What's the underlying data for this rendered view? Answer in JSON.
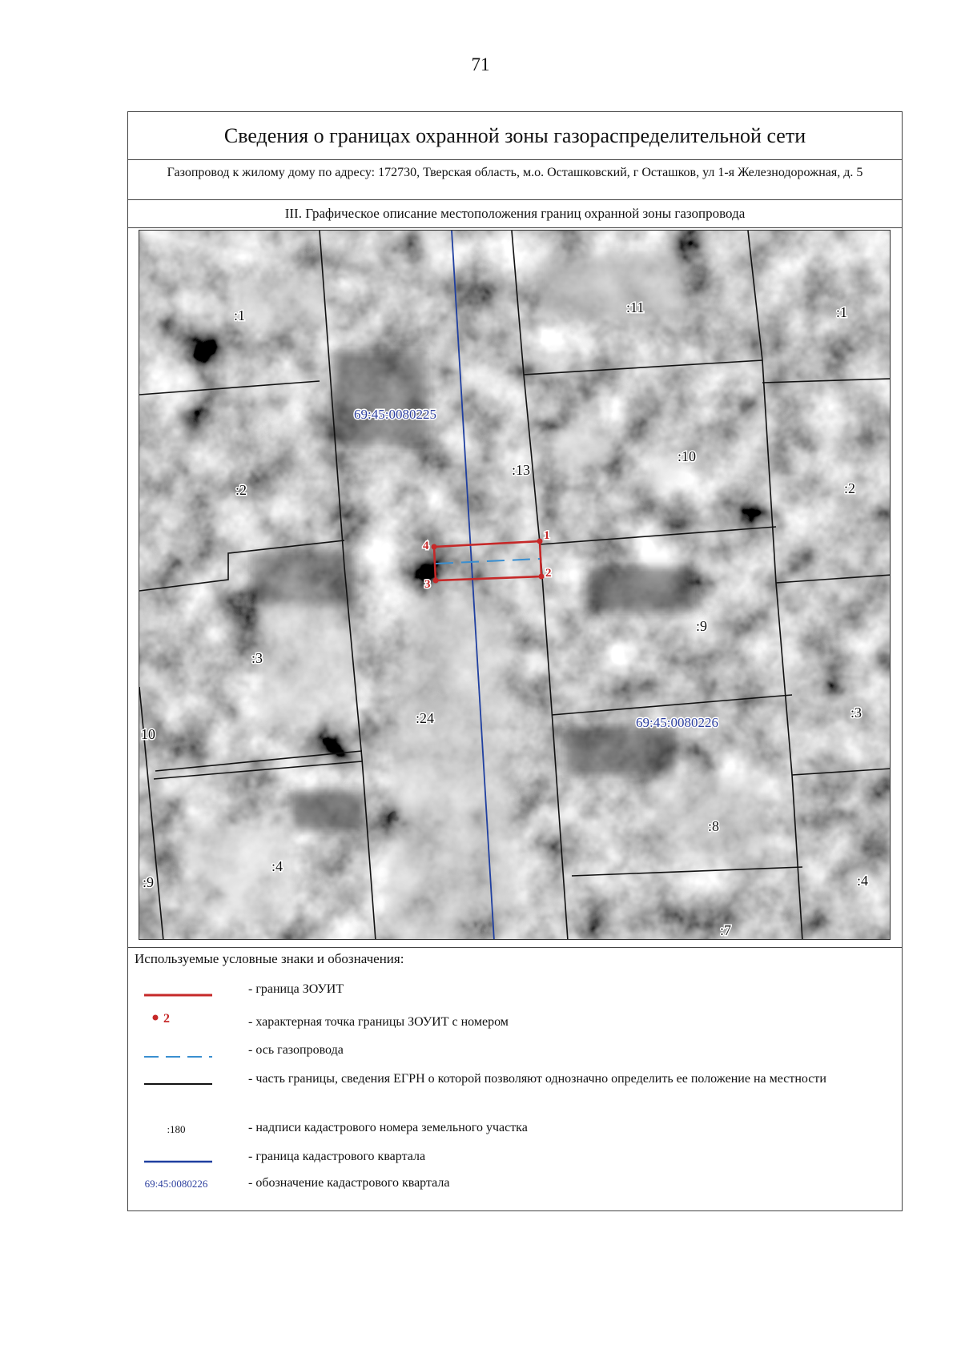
{
  "page_number": "71",
  "header": {
    "title": "Сведения о границах охранной зоны газораспределительной сети",
    "subtitle": "Газопровод к жилому дому по адресу: 172730, Тверская область, м.о. Осташковский, г Осташков, ул 1-я Железнодорожная, д. 5",
    "section": "III. Графическое описание местоположения границ охранной зоны газопровода"
  },
  "map": {
    "parcel_labels": [
      ":1",
      ":11",
      ":1",
      ":10",
      ":13",
      ":2",
      ":2",
      ":9",
      ":3",
      ":24",
      ":3",
      "10",
      ":8",
      ":4",
      ":9",
      ":4",
      ":7"
    ],
    "quarter_labels": [
      "69:45:0080225",
      "69:45:0080226"
    ],
    "points": [
      "1",
      "2",
      "3",
      "4"
    ],
    "colors": {
      "zone": "#c62828",
      "axis": "#3a8fd0",
      "quarter_border": "#1f3fa0",
      "parcel_border": "#111111",
      "quarter_label": "#2c3f9e"
    }
  },
  "legend": {
    "title": "Используемые условные знаки и обозначения:",
    "items": [
      {
        "desc": "- граница ЗОУИТ"
      },
      {
        "symbol_text": "2",
        "desc": "- характерная точка границы ЗОУИТ с номером"
      },
      {
        "desc": "- ось газопровода"
      },
      {
        "desc": "- часть границы, сведения ЕГРН о которой позволяют однозначно определить ее положение на местности"
      },
      {
        "symbol_text": ":180",
        "desc": "- надписи кадастрового номера земельного участка"
      },
      {
        "desc": "- граница кадастрового квартала"
      },
      {
        "symbol_text": "69:45:0080226",
        "desc": "- обозначение кадастрового квартала"
      }
    ]
  }
}
